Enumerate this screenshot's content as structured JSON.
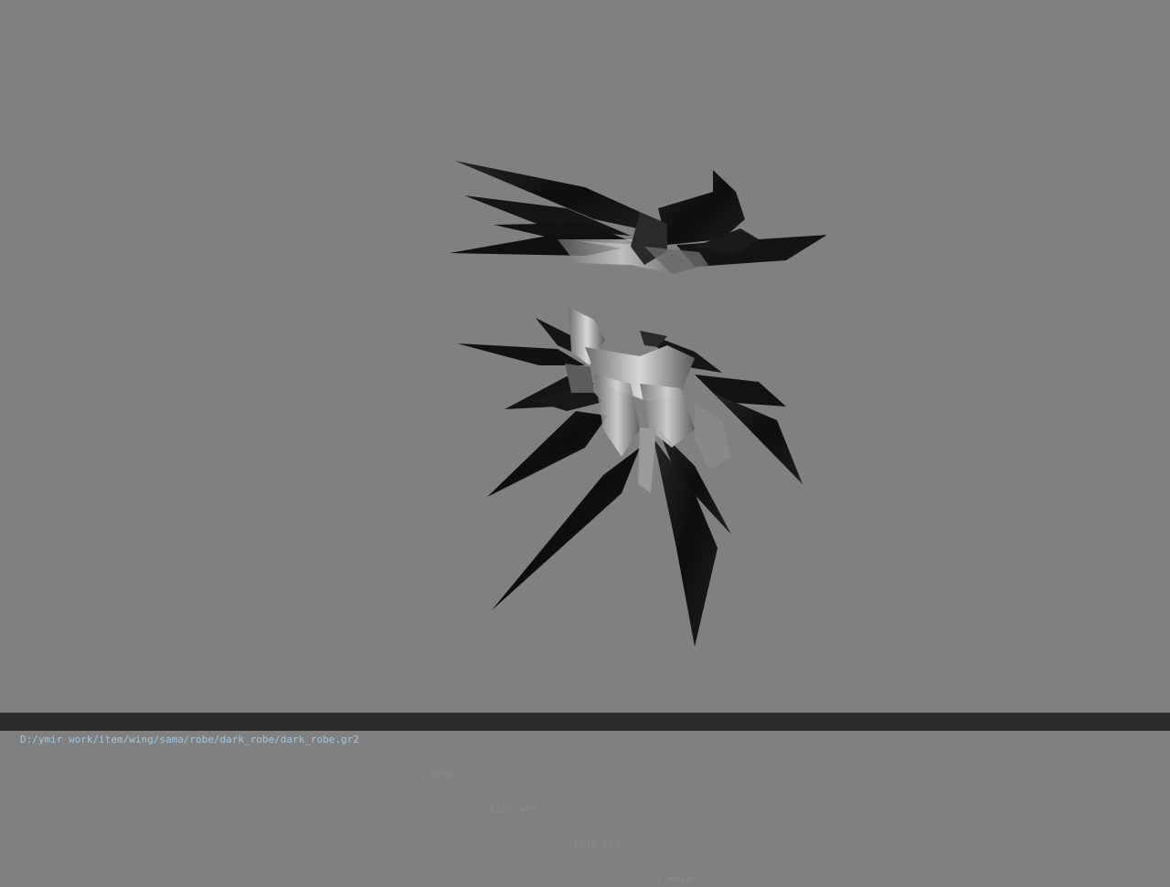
{
  "status_bar": {
    "file_path": "D:/ymir work/item/wing/sama/robe/dark_robe/dark_robe.gr2",
    "separator": "|",
    "mesh_count": "1 mesh",
    "vertex_count": "1186 vtx",
    "triangle_count": "1596 tri",
    "anim_count": "1 anim"
  },
  "colors": {
    "viewport_background": "#808080",
    "status_bar_background": "#2b2b2b",
    "path_text": "#9fc7e0",
    "stat_text": "#8a8a8a"
  }
}
